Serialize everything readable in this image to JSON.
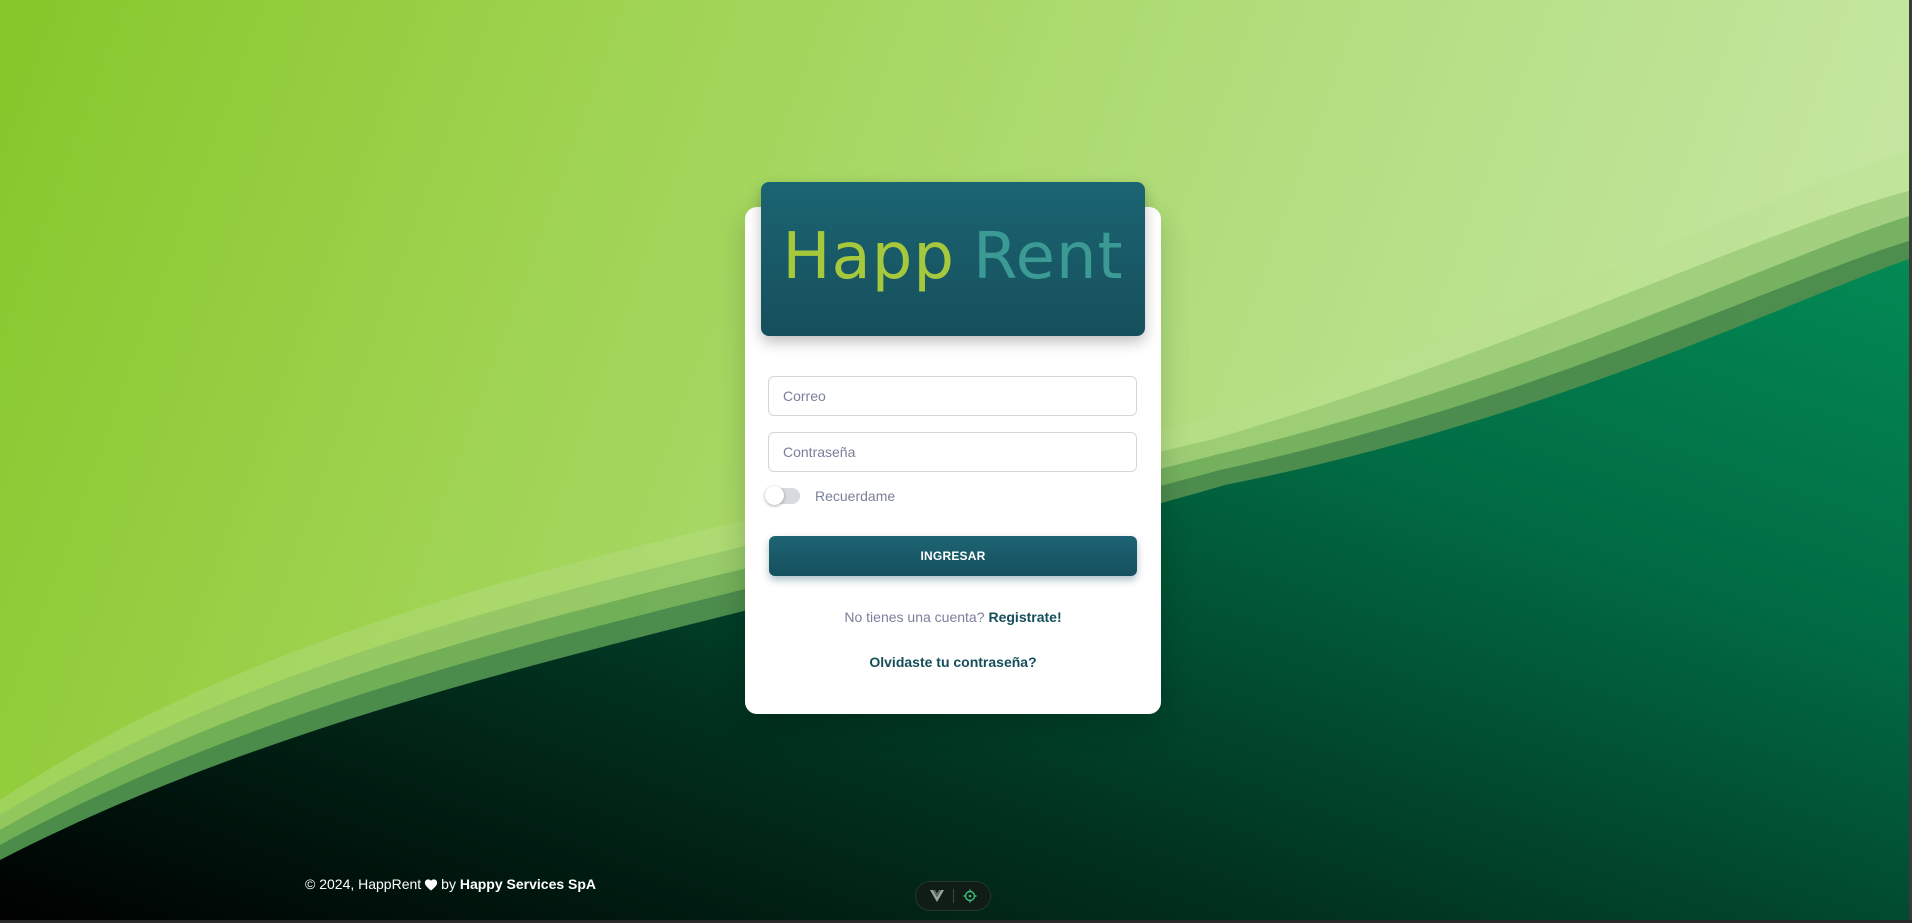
{
  "app": {
    "brand_first": "Happ",
    "brand_second": "Rent"
  },
  "login": {
    "email_placeholder": "Correo",
    "password_placeholder": "Contraseña",
    "remember_label": "Recuerdame",
    "remember_checked": false,
    "submit_label": "INGRESAR",
    "signup_prompt": "No tienes una cuenta?",
    "signup_link": "Registrate!",
    "forgot_link": "Olvidaste tu contraseña?"
  },
  "footer": {
    "copyright": "© 2024, HappRent",
    "by": "by",
    "company": "Happy Services SpA",
    "heart_icon": "heart-icon"
  },
  "devtools": {
    "icons": [
      "vue-logo-icon",
      "inspector-target-icon"
    ]
  },
  "colors": {
    "brand_dark": "#154e5a",
    "logo_green": "#a6c83c",
    "logo_teal": "#3b9a93",
    "bg_light": "#9dd24d",
    "bg_dark": "#003d26"
  }
}
